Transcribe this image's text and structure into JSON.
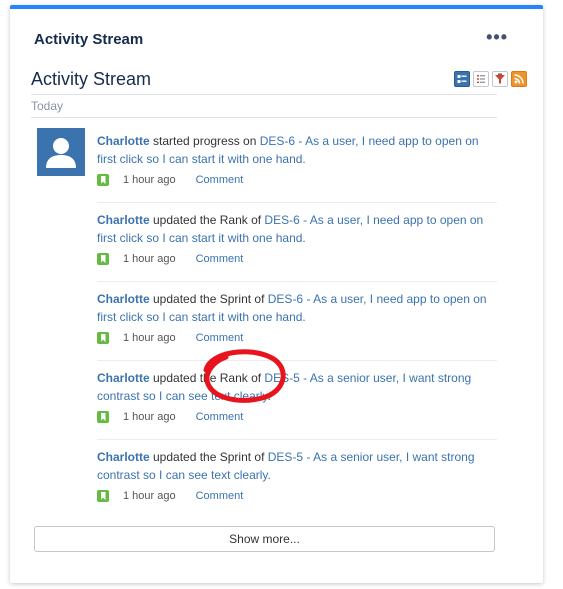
{
  "gadget": {
    "title": "Activity Stream",
    "menu_label": "•••"
  },
  "stream": {
    "title": "Activity Stream",
    "view_icons": [
      "full-view-icon",
      "list-view-icon",
      "filter-icon",
      "rss-feed-icon"
    ],
    "section_label": "Today"
  },
  "entries": [
    {
      "user": "Charlotte",
      "action": " started progress on ",
      "link": "DES-6 - As a user, I need app to open on first click so I can start it with one hand.",
      "tail": "",
      "time": "1 hour ago",
      "comment": "Comment"
    },
    {
      "user": "Charlotte",
      "action": " updated the Rank of ",
      "link": "DES-6 - As a user, I need app to open on first click so I can start it with one hand.",
      "tail": "",
      "time": "1 hour ago",
      "comment": "Comment"
    },
    {
      "user": "Charlotte",
      "action": " updated the Sprint of ",
      "link": "DES-6 - As a user, I need app to open on first click so I can start it with one hand.",
      "tail": "",
      "time": "1 hour ago",
      "comment": "Comment"
    },
    {
      "user": "Charlotte",
      "action": " updated the Rank of ",
      "link": "DES-5 - As a senior user, I want strong contrast so I can see text clearly",
      "tail": ".",
      "time": "1 hour ago",
      "comment": "Comment"
    },
    {
      "user": "Charlotte",
      "action": " updated the Sprint of ",
      "link": "DES-5 - As a senior user, I want strong contrast so I can see text clearly.",
      "tail": "",
      "time": "1 hour ago",
      "comment": "Comment"
    }
  ],
  "show_more_label": "Show more...",
  "colors": {
    "accent_bar": "#2684ff",
    "link": "#3b73af",
    "type_icon": "#65ba43",
    "annotation": "#e8141d"
  }
}
